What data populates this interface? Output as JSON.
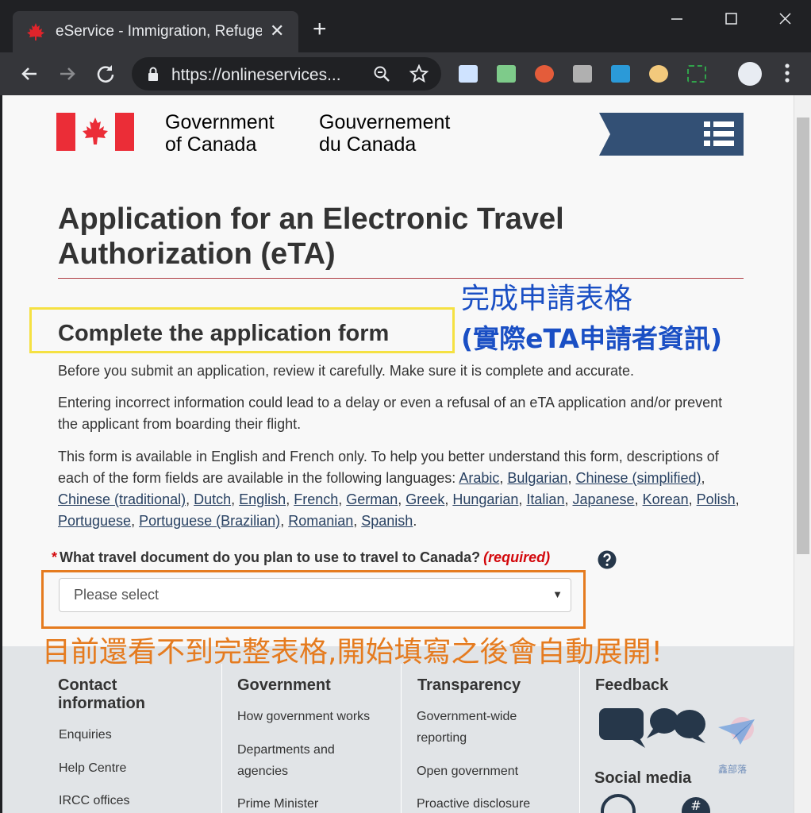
{
  "browser": {
    "tab_title": "eService - Immigration, Refugee",
    "new_tab": "+",
    "tab_close": "✕",
    "url": "https://onlineservices..."
  },
  "header": {
    "gov_en": "Government of Canada",
    "gov_en_line1": "Government",
    "gov_en_line2": "of Canada",
    "gov_fr_line1": "Gouvernement",
    "gov_fr_line2": "du Canada",
    "flag_color": "#eb2d37",
    "menu_color": "#335075"
  },
  "main": {
    "title_line1": "Application for an Electronic Travel",
    "title_line2": "Authorization (eTA)",
    "section_heading": "Complete the application form",
    "para1": "Before you submit an application, review it carefully. Make sure it is complete and accurate.",
    "para2": "Entering incorrect information could lead to a delay or even a refusal of an eTA application and/or prevent the applicant from boarding their flight.",
    "para3_intro": "This form is available in English and French only. To help you better understand this form, descriptions of each of the form fields are available in the following languages:",
    "languages": [
      "Arabic",
      "Bulgarian",
      "Chinese (simplified)",
      "Chinese (traditional)",
      "Dutch",
      "English",
      "French",
      "German",
      "Greek",
      "Hungarian",
      "Italian",
      "Japanese",
      "Korean",
      "Polish",
      "Portuguese",
      "Portuguese (Brazilian)",
      "Romanian",
      "Spanish"
    ],
    "question": "What travel document do you plan to use to travel to Canada?",
    "required_mark": "*",
    "required_text": "(required)",
    "select_value": "Please select"
  },
  "annotations": {
    "note1": "完成申請表格",
    "note2": "(實際eTA申請者資訊)",
    "note3": "目前還看不到完整表格,開始填寫之後會自動展開!",
    "note1_color": "#1a4fc4",
    "note3_color": "#e57b1f"
  },
  "footer": {
    "contact": {
      "heading_line1": "Contact",
      "heading_line2": "information",
      "links": [
        "Enquiries",
        "Help Centre",
        "IRCC offices"
      ]
    },
    "government": {
      "heading": "Government",
      "links": [
        "How government works",
        "Departments and",
        "agencies",
        "Prime Minister"
      ]
    },
    "transparency": {
      "heading": "Transparency",
      "links": [
        "Government-wide",
        "reporting",
        "Open government",
        "Proactive disclosure"
      ]
    },
    "feedback": {
      "heading": "Feedback"
    },
    "social": {
      "heading": "Social media"
    },
    "watermark_text": "鑫部落"
  }
}
